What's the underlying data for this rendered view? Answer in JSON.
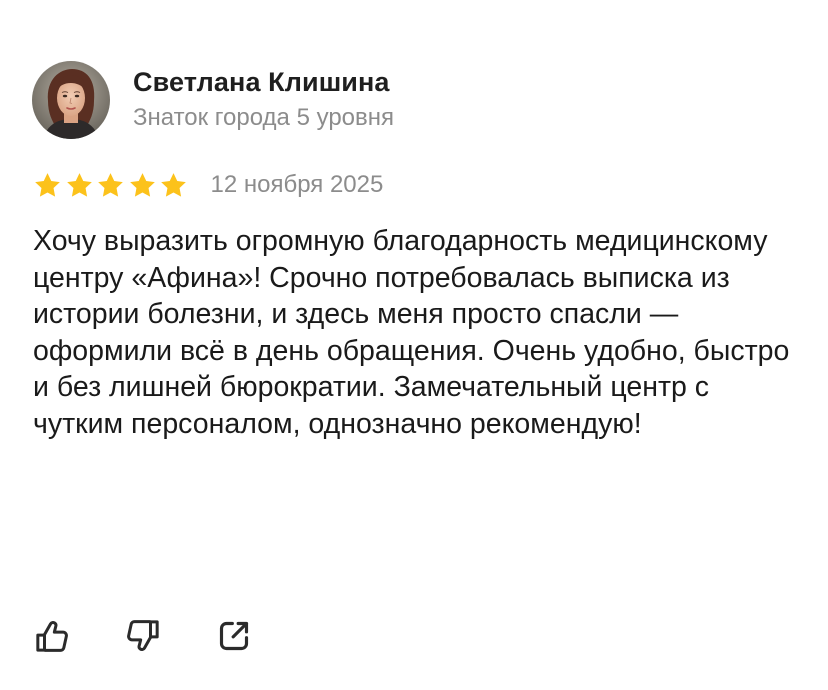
{
  "author": {
    "name": "Светлана Клишина",
    "level": "Знаток города 5 уровня"
  },
  "rating": {
    "stars": 5,
    "max": 5,
    "star_color": "#fcc21b"
  },
  "date": "12 ноября 2025",
  "text": "Хочу выразить огромную благодарность медицинскому центру «Афина»! Срочно потребовалась выписка из истории болезни, и здесь меня просто спасли — оформили всё в день обращения. Очень удобно, быстро и без лишней бюрократии. Замечательный центр с чутким персоналом, однозначно рекомендую!",
  "actions": [
    {
      "icon": "thumbs-up-icon"
    },
    {
      "icon": "thumbs-down-icon"
    },
    {
      "icon": "share-icon"
    }
  ]
}
